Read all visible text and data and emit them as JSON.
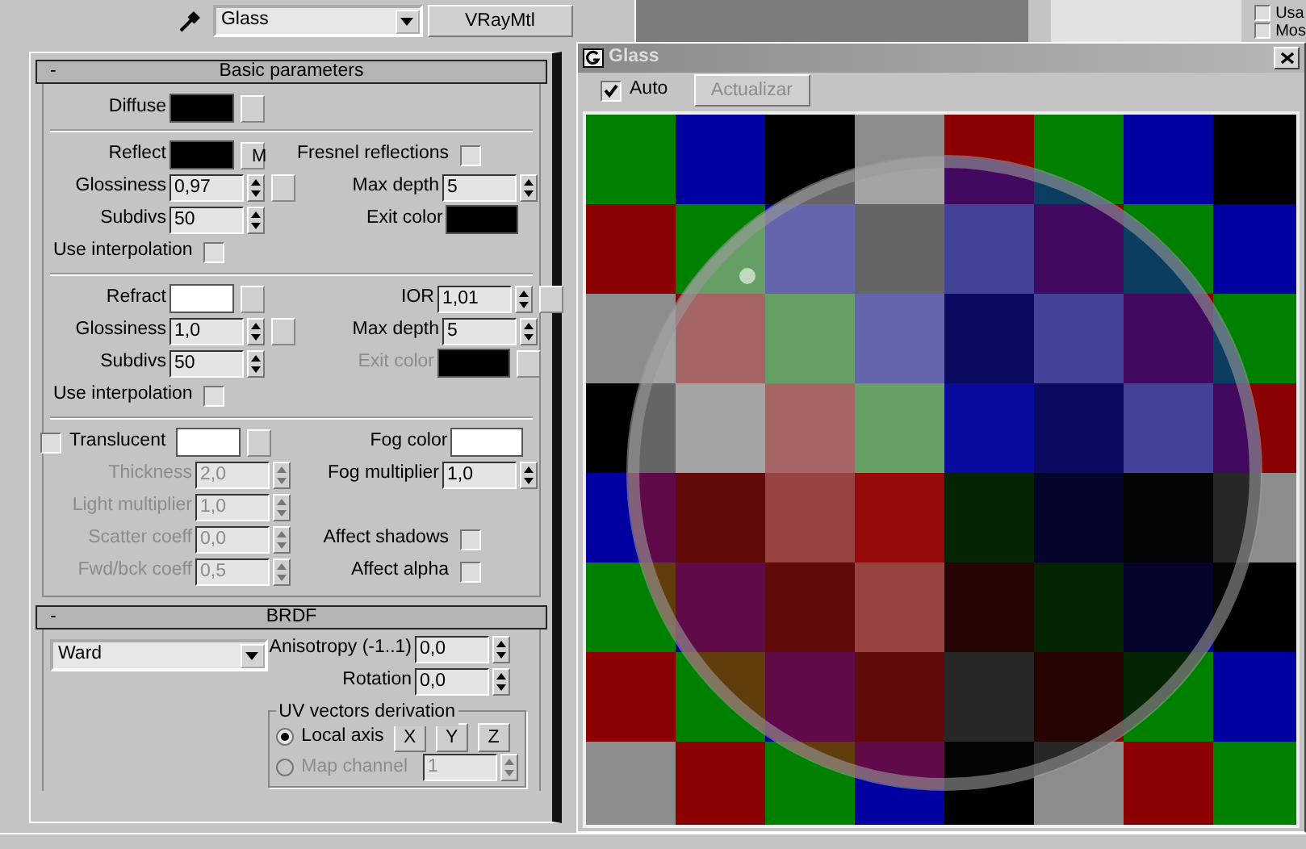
{
  "material": {
    "name": "Glass",
    "type": "VRayMtl"
  },
  "background_options": [
    {
      "label": "Usa",
      "checked": false
    },
    {
      "label": "Mos",
      "checked": false
    }
  ],
  "basic": {
    "toggle": "-",
    "title": "Basic parameters",
    "groups": [
      [
        {
          "left": {
            "kind": "color",
            "label": "Diffuse",
            "color": "#000000",
            "map_slot": true
          }
        }
      ],
      [
        {
          "left": {
            "kind": "color",
            "label": "Reflect",
            "color": "#000000",
            "map": "M"
          },
          "right": {
            "kind": "check",
            "label": "Fresnel reflections",
            "checked": false
          }
        },
        {
          "left": {
            "kind": "spinner",
            "label": "Glossiness",
            "value": "0,97",
            "map_slot": true
          },
          "right": {
            "kind": "spinner",
            "label": "Max depth",
            "value": "5"
          }
        },
        {
          "left": {
            "kind": "spinner",
            "label": "Subdivs",
            "value": "50"
          },
          "right": {
            "kind": "color",
            "label": "Exit color",
            "color": "#000000"
          }
        },
        {
          "left": {
            "kind": "check",
            "label": "Use interpolation",
            "checked": false
          }
        }
      ],
      [
        {
          "left": {
            "kind": "color",
            "label": "Refract",
            "color": "#ffffff",
            "map_slot": true
          },
          "right": {
            "kind": "spinner",
            "label": "IOR",
            "value": "1,01",
            "map_slot": true
          }
        },
        {
          "left": {
            "kind": "spinner",
            "label": "Glossiness",
            "value": "1,0",
            "map_slot": true
          },
          "right": {
            "kind": "spinner",
            "label": "Max depth",
            "value": "5"
          }
        },
        {
          "left": {
            "kind": "spinner",
            "label": "Subdivs",
            "value": "50"
          },
          "right": {
            "kind": "color",
            "label": "Exit color",
            "color": "#000000",
            "disabled": true,
            "map_slot": true
          }
        },
        {
          "left": {
            "kind": "check",
            "label": "Use interpolation",
            "checked": false
          }
        }
      ],
      [
        {
          "left": {
            "kind": "check_color",
            "label": "Translucent",
            "checked": false,
            "color": "#ffffff",
            "map_slot": true
          },
          "right": {
            "kind": "color",
            "label": "Fog color",
            "color": "#ffffff"
          }
        },
        {
          "left": {
            "kind": "spinner",
            "label": "Thickness",
            "value": "2,0",
            "disabled": true
          },
          "right": {
            "kind": "spinner",
            "label": "Fog multiplier",
            "value": "1,0"
          }
        },
        {
          "left": {
            "kind": "spinner",
            "label": "Light multiplier",
            "value": "1,0",
            "disabled": true
          }
        },
        {
          "left": {
            "kind": "spinner",
            "label": "Scatter coeff",
            "value": "0,0",
            "disabled": true
          },
          "right": {
            "kind": "check",
            "label": "Affect shadows",
            "checked": false
          }
        },
        {
          "left": {
            "kind": "spinner",
            "label": "Fwd/bck coeff",
            "value": "0,5",
            "disabled": true
          },
          "right": {
            "kind": "check",
            "label": "Affect alpha",
            "checked": false
          }
        }
      ]
    ]
  },
  "brdf": {
    "toggle": "-",
    "title": "BRDF",
    "type": "Ward",
    "anisotropy": {
      "label": "Anisotropy (-1..1)",
      "value": "0,0"
    },
    "rotation": {
      "label": "Rotation",
      "value": "0,0"
    },
    "uv": {
      "title": "UV vectors derivation",
      "options": [
        {
          "label": "Local axis",
          "selected": true,
          "disabled": false,
          "axes": [
            "X",
            "Y",
            "Z"
          ]
        },
        {
          "label": "Map channel",
          "selected": false,
          "disabled": true,
          "value": "1"
        }
      ]
    }
  },
  "preview": {
    "title": "Glass",
    "auto": {
      "label": "Auto",
      "checked": true
    },
    "update": {
      "label": "Actualizar",
      "disabled": true
    }
  }
}
